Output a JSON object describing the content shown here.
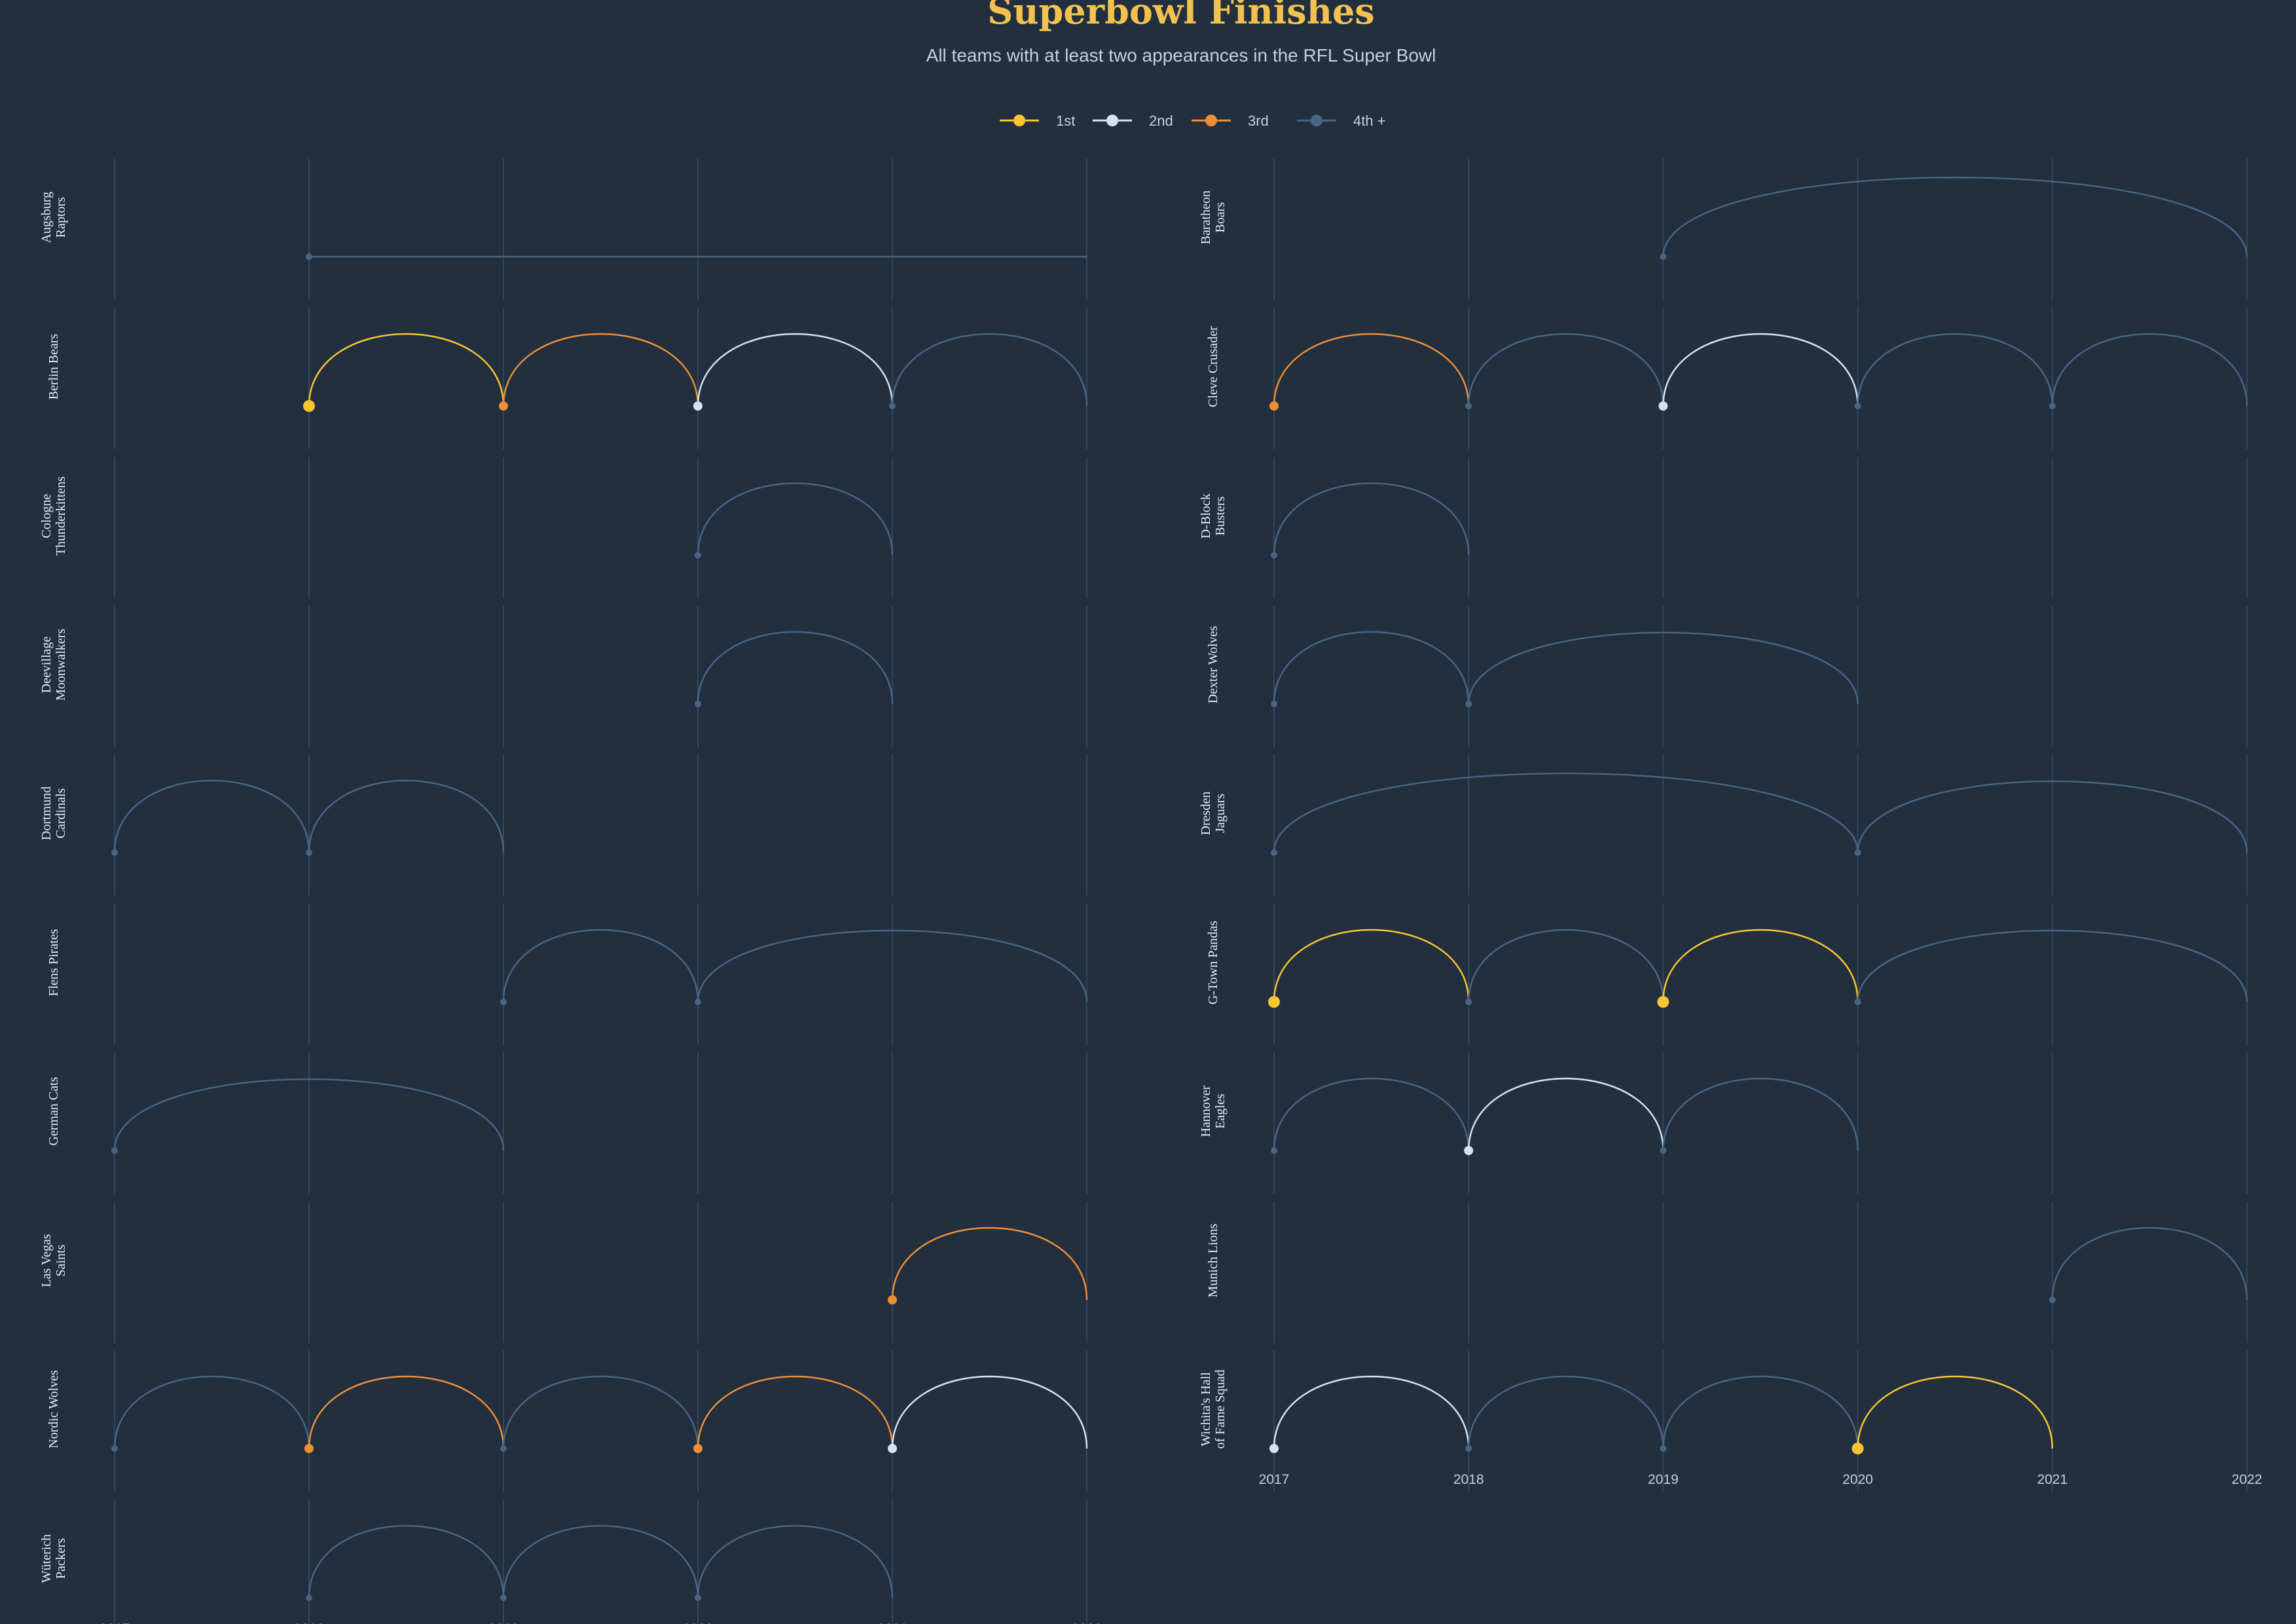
{
  "title": "Superbowl Finishes",
  "subtitle": "All teams with at least two appearances in the RFL Super Bowl",
  "legend": [
    {
      "label": "1st",
      "color": "#f9c531"
    },
    {
      "label": "2nd",
      "color": "#d5e2f1"
    },
    {
      "label": "3rd",
      "color": "#ee8e35"
    },
    {
      "label": "4th +",
      "color": "#4a6582"
    }
  ],
  "colors": {
    "background": "#212f3f",
    "title": "#f2c14e",
    "subtitle": "#c3cfdc",
    "grid": "#33465a",
    "label": "#e6edf5",
    "tick": "#c3cfdc"
  },
  "chart_data": {
    "type": "line",
    "x_ticks": [
      "2017",
      "2018",
      "2019",
      "2020",
      "2021",
      "2022"
    ],
    "xlim": [
      2017,
      2022
    ],
    "grid": "vertical",
    "legend_position": "top-center",
    "teams": [
      {
        "name": "Augsburg Raptors",
        "label_lines": [
          "Augsburg",
          "Raptors"
        ],
        "appearances": [
          {
            "year": 2018,
            "place": 4
          },
          {
            "year": 2022,
            "place": 4
          }
        ]
      },
      {
        "name": "Baratheon Boars",
        "label_lines": [
          "Baratheon",
          "Boars"
        ],
        "appearances": [
          {
            "year": 2019,
            "place": 4
          },
          {
            "year": 2022,
            "place": 4
          }
        ]
      },
      {
        "name": "Berlin Bears",
        "label_lines": [
          "Berlin Bears"
        ],
        "appearances": [
          {
            "year": 2018,
            "place": 1
          },
          {
            "year": 2019,
            "place": 3
          },
          {
            "year": 2020,
            "place": 2
          },
          {
            "year": 2021,
            "place": 4
          },
          {
            "year": 2022,
            "place": 4
          }
        ]
      },
      {
        "name": "Cleve Crusader",
        "label_lines": [
          "Cleve Crusader"
        ],
        "appearances": [
          {
            "year": 2017,
            "place": 3
          },
          {
            "year": 2018,
            "place": 4
          },
          {
            "year": 2019,
            "place": 2
          },
          {
            "year": 2020,
            "place": 4
          },
          {
            "year": 2021,
            "place": 4
          },
          {
            "year": 2022,
            "place": 4
          }
        ]
      },
      {
        "name": "Cologne Thunderkittens",
        "label_lines": [
          "Cologne",
          "Thunderkittens"
        ],
        "appearances": [
          {
            "year": 2020,
            "place": 4
          },
          {
            "year": 2021,
            "place": 4
          }
        ]
      },
      {
        "name": "D-Block Busters",
        "label_lines": [
          "D-Block",
          "Busters"
        ],
        "appearances": [
          {
            "year": 2017,
            "place": 4
          },
          {
            "year": 2018,
            "place": 4
          }
        ]
      },
      {
        "name": "Deevillage Moonwalkers",
        "label_lines": [
          "Deevillage",
          "Moonwalkers"
        ],
        "appearances": [
          {
            "year": 2020,
            "place": 4
          },
          {
            "year": 2021,
            "place": 4
          }
        ]
      },
      {
        "name": "Dexter Wolves",
        "label_lines": [
          "Dexter Wolves"
        ],
        "appearances": [
          {
            "year": 2017,
            "place": 4
          },
          {
            "year": 2018,
            "place": 4
          },
          {
            "year": 2020,
            "place": 4
          }
        ]
      },
      {
        "name": "Dortmund Cardinals",
        "label_lines": [
          "Dortmund",
          "Cardinals"
        ],
        "appearances": [
          {
            "year": 2017,
            "place": 4
          },
          {
            "year": 2018,
            "place": 4
          },
          {
            "year": 2019,
            "place": 4
          }
        ]
      },
      {
        "name": "Dresden Jaguars",
        "label_lines": [
          "Dresden",
          "Jaguars"
        ],
        "appearances": [
          {
            "year": 2017,
            "place": 4
          },
          {
            "year": 2020,
            "place": 4
          },
          {
            "year": 2022,
            "place": 4
          }
        ]
      },
      {
        "name": "Flens Pirates",
        "label_lines": [
          "Flens Pirates"
        ],
        "appearances": [
          {
            "year": 2019,
            "place": 4
          },
          {
            "year": 2020,
            "place": 4
          },
          {
            "year": 2022,
            "place": 4
          }
        ]
      },
      {
        "name": "G-Town Pandas",
        "label_lines": [
          "G-Town Pandas"
        ],
        "appearances": [
          {
            "year": 2017,
            "place": 1
          },
          {
            "year": 2018,
            "place": 4
          },
          {
            "year": 2019,
            "place": 1
          },
          {
            "year": 2020,
            "place": 4
          },
          {
            "year": 2022,
            "place": 4
          }
        ]
      },
      {
        "name": "German Cats",
        "label_lines": [
          "German Cats"
        ],
        "appearances": [
          {
            "year": 2017,
            "place": 4
          },
          {
            "year": 2019,
            "place": 4
          }
        ]
      },
      {
        "name": "Hannover Eagles",
        "label_lines": [
          "Hannover",
          "Eagles"
        ],
        "appearances": [
          {
            "year": 2017,
            "place": 4
          },
          {
            "year": 2018,
            "place": 2
          },
          {
            "year": 2019,
            "place": 4
          },
          {
            "year": 2020,
            "place": 4
          }
        ]
      },
      {
        "name": "Las Vegas Saints",
        "label_lines": [
          "Las Vegas",
          "Saints"
        ],
        "appearances": [
          {
            "year": 2021,
            "place": 3
          },
          {
            "year": 2022,
            "place": 4
          }
        ]
      },
      {
        "name": "Munich Lions",
        "label_lines": [
          "Munich Lions"
        ],
        "appearances": [
          {
            "year": 2021,
            "place": 4
          },
          {
            "year": 2022,
            "place": 4
          }
        ]
      },
      {
        "name": "Nordic Wolves",
        "label_lines": [
          "Nordic Wolves"
        ],
        "appearances": [
          {
            "year": 2017,
            "place": 4
          },
          {
            "year": 2018,
            "place": 3
          },
          {
            "year": 2019,
            "place": 4
          },
          {
            "year": 2020,
            "place": 3
          },
          {
            "year": 2021,
            "place": 2
          },
          {
            "year": 2022,
            "place": 4
          }
        ]
      },
      {
        "name": "Wichita's Hall of Fame Squad",
        "label_lines": [
          "Wichita's Hall",
          "of Fame Squad"
        ],
        "appearances": [
          {
            "year": 2017,
            "place": 2
          },
          {
            "year": 2018,
            "place": 4
          },
          {
            "year": 2019,
            "place": 4
          },
          {
            "year": 2020,
            "place": 1
          },
          {
            "year": 2021,
            "place": 4
          }
        ]
      },
      {
        "name": "Wüterich Packers",
        "label_lines": [
          "Wüterich",
          "Packers"
        ],
        "appearances": [
          {
            "year": 2018,
            "place": 4
          },
          {
            "year": 2019,
            "place": 4
          },
          {
            "year": 2020,
            "place": 4
          },
          {
            "year": 2021,
            "place": 4
          }
        ]
      }
    ]
  }
}
